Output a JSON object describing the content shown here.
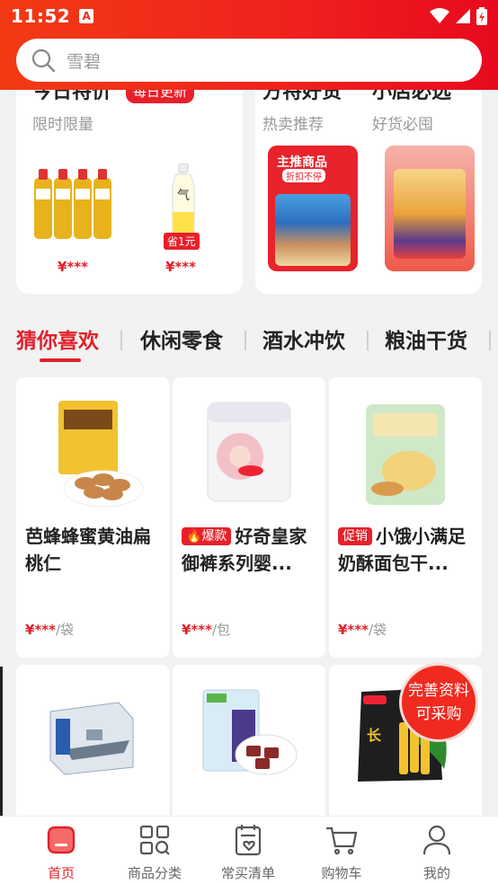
{
  "status_bar": {
    "time": "11:52",
    "notice_glyph": "A"
  },
  "search": {
    "placeholder": "雪碧"
  },
  "featured": {
    "left": {
      "title": "今日特价",
      "badge": "每日更新",
      "subtitle": "限时限量",
      "prices": [
        "¥***",
        "¥***"
      ],
      "save_tag": "省1元"
    },
    "right": {
      "col1": {
        "title": "方特好货",
        "subtitle": "热卖推荐"
      },
      "col2": {
        "title": "小店必选",
        "subtitle": "好货必囤"
      },
      "promo_label_1": "主推商品",
      "promo_label_2": "折扣不停"
    }
  },
  "tabs": [
    {
      "label": "猜你喜欢",
      "active": true
    },
    {
      "label": "休闲零食"
    },
    {
      "label": "酒水冲饮"
    },
    {
      "label": "粮油干货"
    }
  ],
  "products": [
    {
      "tag": "",
      "name": "芭蜂蜂蜜黄油扁桃仁",
      "price": "¥***",
      "unit": "/袋"
    },
    {
      "tag": "爆款",
      "name": "好奇皇家御裤系列婴...",
      "price": "¥***",
      "unit": "/包"
    },
    {
      "tag": "促销",
      "name": "小饿小满足奶酥面包干...",
      "price": "¥***",
      "unit": "/袋"
    },
    {
      "tag": "",
      "name": "",
      "price": "",
      "unit": ""
    },
    {
      "tag": "",
      "name": "",
      "price": "",
      "unit": ""
    },
    {
      "tag": "",
      "name": "",
      "price": "",
      "unit": ""
    }
  ],
  "complete_button": {
    "line1": "完善资料",
    "line2": "可采购"
  },
  "bottom_nav": [
    {
      "label": "首页",
      "icon": "home-icon",
      "active": true
    },
    {
      "label": "商品分类",
      "icon": "category-icon"
    },
    {
      "label": "常买清单",
      "icon": "list-icon"
    },
    {
      "label": "购物车",
      "icon": "cart-icon"
    },
    {
      "label": "我的",
      "icon": "profile-icon"
    }
  ],
  "colors": {
    "brand": "#e8202a",
    "header_start": "#f23a14",
    "header_end": "#e8091f"
  }
}
